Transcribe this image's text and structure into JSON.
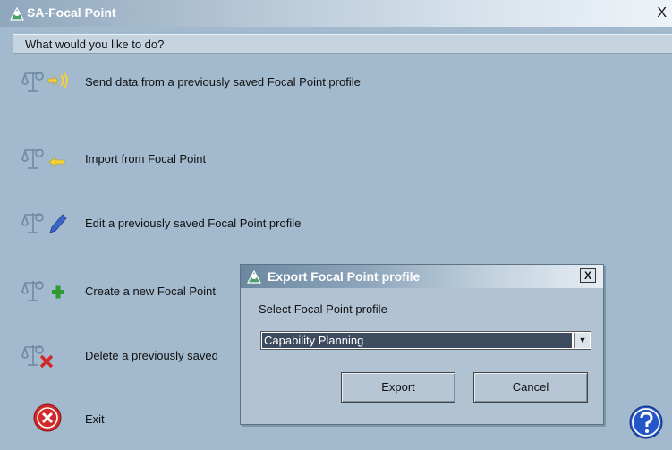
{
  "window": {
    "title": "SA-Focal Point",
    "close_label": "X",
    "prompt": "What would you like to do?"
  },
  "actions": [
    {
      "label": "Send data from a previously saved Focal Point profile",
      "icon": "scale-send-icon"
    },
    {
      "label": "Import from Focal Point",
      "icon": "scale-import-icon"
    },
    {
      "label": "Edit a previously saved Focal Point profile",
      "icon": "scale-edit-icon"
    },
    {
      "label": "Create a new Focal Point",
      "icon": "scale-add-icon"
    },
    {
      "label": "Delete a previously saved",
      "icon": "scale-delete-icon"
    }
  ],
  "exit_label": "Exit",
  "dialog": {
    "title": "Export Focal Point profile",
    "close_label": "X",
    "field_label": "Select Focal Point profile",
    "selected_profile": "Capability Planning",
    "export_label": "Export",
    "cancel_label": "Cancel"
  },
  "colors": {
    "background": "#a3b9cd",
    "title_text": "#ffffff",
    "selection": "#3c4b5e",
    "exit_red": "#d22a2a",
    "help_blue": "#2456c8",
    "add_green": "#2f9a2f",
    "arrow_yellow": "#f3d23a"
  }
}
